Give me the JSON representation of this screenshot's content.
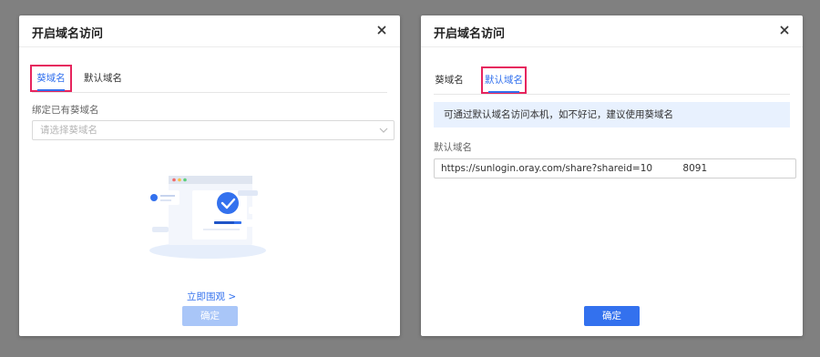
{
  "dialog_left": {
    "title": "开启域名访问",
    "tabs": [
      {
        "label": "葵域名",
        "active": true
      },
      {
        "label": "默认域名",
        "active": false
      }
    ],
    "field_label": "绑定已有葵域名",
    "select_placeholder": "请选择葵域名",
    "link_label": "立即围观 >",
    "confirm_label": "确定",
    "confirm_disabled": true
  },
  "dialog_right": {
    "title": "开启域名访问",
    "tabs": [
      {
        "label": "葵域名",
        "active": false
      },
      {
        "label": "默认域名",
        "active": true
      }
    ],
    "info_text": "可通过默认域名访问本机，如不好记，建议使用葵域名",
    "field_label": "默认域名",
    "url_value": "https://sunlogin.oray.com/share?shareid=10          8091",
    "confirm_label": "确定"
  },
  "colors": {
    "accent": "#3371ee",
    "highlight_box": "#e6245d",
    "banner_bg": "#e8f1fe",
    "disabled_button": "#a9c6f8"
  },
  "icons": [
    "close-icon",
    "chevron-down-icon",
    "empty-state-illustration"
  ]
}
